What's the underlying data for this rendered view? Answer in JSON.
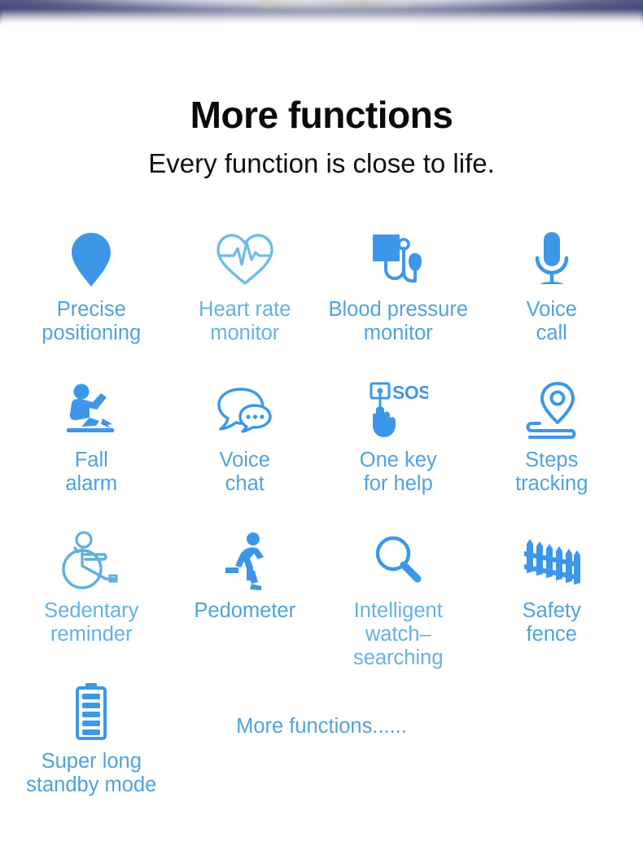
{
  "header": {
    "title": "More functions",
    "subtitle": "Every function is close to life."
  },
  "colors": {
    "icon_blue": "#3d97e8",
    "icon_light_blue": "#6ebce8",
    "label_blue": "#4fa3dd",
    "title_black": "#0a0a0a",
    "background": "#ffffff",
    "top_band": "#39416b"
  },
  "features": [
    {
      "icon": "map-pin-icon",
      "label": "Precise\npositioning"
    },
    {
      "icon": "heart-pulse-icon",
      "label": "Heart rate\nmonitor"
    },
    {
      "icon": "blood-pressure-icon",
      "label": "Blood pressure\nmonitor"
    },
    {
      "icon": "microphone-icon",
      "label": "Voice\ncall"
    },
    {
      "icon": "falling-person-icon",
      "label": "Fall\nalarm"
    },
    {
      "icon": "speech-bubbles-icon",
      "label": "Voice\nchat"
    },
    {
      "icon": "sos-hand-icon",
      "label": "One key\nfor help"
    },
    {
      "icon": "pin-route-icon",
      "label": "Steps\ntracking"
    },
    {
      "icon": "wheelchair-icon",
      "label": "Sedentary\nreminder"
    },
    {
      "icon": "running-person-icon",
      "label": "Pedometer"
    },
    {
      "icon": "magnifier-icon",
      "label": "Intelligent\nwatch–searching"
    },
    {
      "icon": "fence-icon",
      "label": "Safety\nfence"
    },
    {
      "icon": "battery-icon",
      "label": "Super long\nstandby mode"
    }
  ],
  "footer": {
    "more_text": "More functions......"
  },
  "sos_badge_text": "SOS"
}
